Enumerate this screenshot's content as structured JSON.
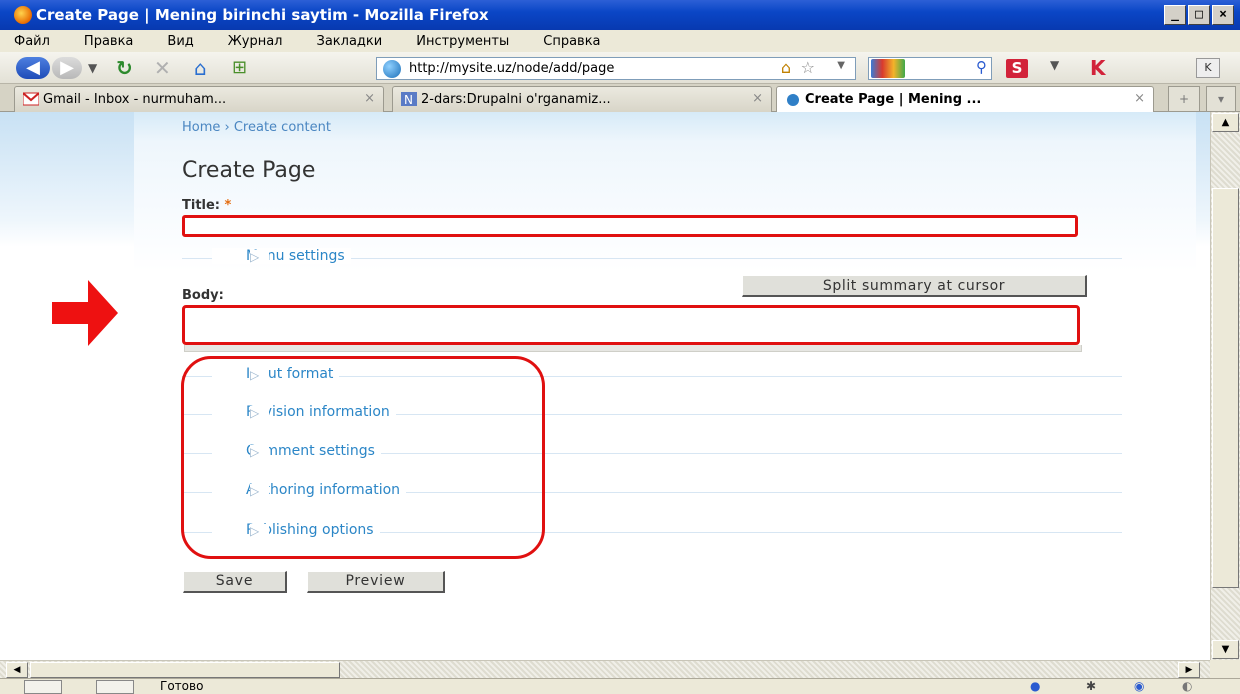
{
  "window": {
    "title": "Create Page | Mening birinchi saytim - Mozilla Firefox",
    "controls": [
      "_",
      "□",
      "×"
    ]
  },
  "menubar": [
    "Файл",
    "Правка",
    "Вид",
    "Журнал",
    "Закладки",
    "Инструменты",
    "Справка"
  ],
  "toolbar": {
    "url": "http://mysite.uz/node/add/page",
    "addon_s": "S"
  },
  "tabs": [
    {
      "label": "Gmail - Inbox - nurmuham...",
      "active": false,
      "close": "×"
    },
    {
      "label": "2-dars:Drupalni o'rganamiz...",
      "active": false,
      "close": "×"
    },
    {
      "label": "Create Page | Mening ...",
      "active": true,
      "close": "×"
    }
  ],
  "page": {
    "breadcrumb": "Home › Create content",
    "title": "Create Page",
    "title_label": "Title:",
    "required_mark": "*",
    "menu_settings": "Menu settings",
    "body_label": "Body:",
    "split_button": "Split summary at cursor",
    "fieldsets": [
      "Input format",
      "Revision information",
      "Comment settings",
      "Authoring information",
      "Publishing options"
    ],
    "save_button": "Save",
    "preview_button": "Preview"
  },
  "status": {
    "text": "Готово"
  },
  "colors": {
    "link": "#2b86c7",
    "highlight": "#e01010",
    "titlebar": "#0a46c6"
  }
}
